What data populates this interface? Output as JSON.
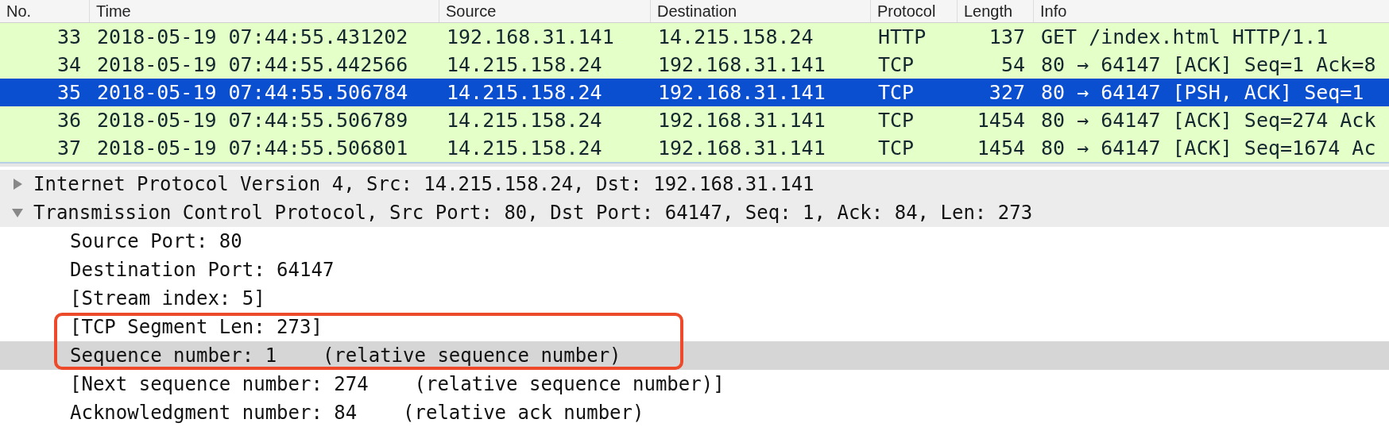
{
  "packet_list": {
    "columns": [
      {
        "label": "No.",
        "kind": "number"
      },
      {
        "label": "Time",
        "kind": "text"
      },
      {
        "label": "Source",
        "kind": "text"
      },
      {
        "label": "Destination",
        "kind": "text"
      },
      {
        "label": "Protocol",
        "kind": "text"
      },
      {
        "label": "Length",
        "kind": "number"
      },
      {
        "label": "Info",
        "kind": "text"
      }
    ],
    "rows": [
      {
        "selected": false,
        "cells": [
          "33",
          "2018-05-19 07:44:55.431202",
          "192.168.31.141",
          "14.215.158.24",
          "HTTP",
          "137",
          "GET /index.html HTTP/1.1"
        ]
      },
      {
        "selected": false,
        "cells": [
          "34",
          "2018-05-19 07:44:55.442566",
          "14.215.158.24",
          "192.168.31.141",
          "TCP",
          "54",
          "80 → 64147 [ACK] Seq=1 Ack=8"
        ]
      },
      {
        "selected": true,
        "cells": [
          "35",
          "2018-05-19 07:44:55.506784",
          "14.215.158.24",
          "192.168.31.141",
          "TCP",
          "327",
          "80 → 64147 [PSH, ACK] Seq=1"
        ]
      },
      {
        "selected": false,
        "cells": [
          "36",
          "2018-05-19 07:44:55.506789",
          "14.215.158.24",
          "192.168.31.141",
          "TCP",
          "1454",
          "80 → 64147 [ACK] Seq=274 Ack"
        ]
      },
      {
        "selected": false,
        "cells": [
          "37",
          "2018-05-19 07:44:55.506801",
          "14.215.158.24",
          "192.168.31.141",
          "TCP",
          "1454",
          "80 → 64147 [ACK] Seq=1674 Ac"
        ]
      }
    ]
  },
  "packet_details": [
    {
      "text": "Internet Protocol Version 4, Src: 14.215.158.24, Dst: 192.168.31.141",
      "expanded": false
    },
    {
      "text": "Transmission Control Protocol, Src Port: 80, Dst Port: 64147, Seq: 1, Ack: 84, Len: 273",
      "expanded": true,
      "children": [
        {
          "text": "Source Port: 80",
          "selected": false,
          "boxed": false
        },
        {
          "text": "Destination Port: 64147",
          "selected": false,
          "boxed": false
        },
        {
          "text": "[Stream index: 5]",
          "selected": false,
          "boxed": false
        },
        {
          "text": "[TCP Segment Len: 273]",
          "selected": false,
          "boxed": true
        },
        {
          "text": "Sequence number: 1    (relative sequence number)",
          "selected": true,
          "boxed": true
        },
        {
          "text": "[Next sequence number: 274    (relative sequence number)]",
          "selected": false,
          "boxed": false
        },
        {
          "text": "Acknowledgment number: 84    (relative ack number)",
          "selected": false,
          "boxed": false
        }
      ]
    }
  ]
}
